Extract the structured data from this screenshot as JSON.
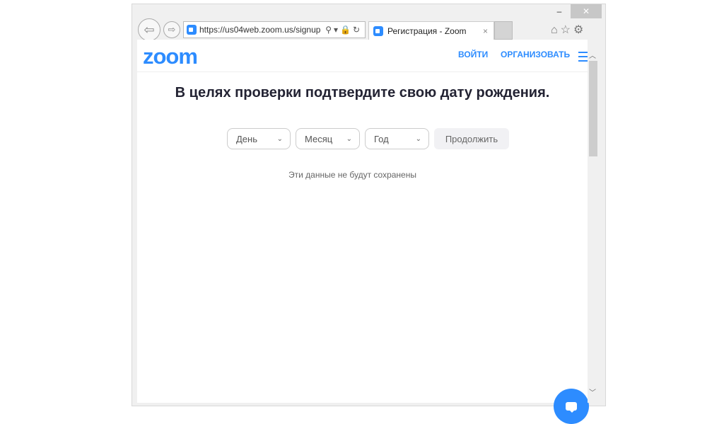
{
  "browser": {
    "url": "https://us04web.zoom.us/signup",
    "tab_title": "Регистрация - Zoom",
    "close_tab": "×",
    "minimize": "–",
    "maximize": "□",
    "close": "✕"
  },
  "header": {
    "logo": "zoom",
    "login": "ВОЙТИ",
    "host": "ОРГАНИЗОВАТЬ"
  },
  "main": {
    "title": "В целях проверки подтвердите свою дату рождения.",
    "day": "День",
    "month": "Месяц",
    "year": "Год",
    "continue": "Продолжить",
    "note": "Эти данные не будут сохранены"
  },
  "colors": {
    "accent": "#2d8cff"
  }
}
